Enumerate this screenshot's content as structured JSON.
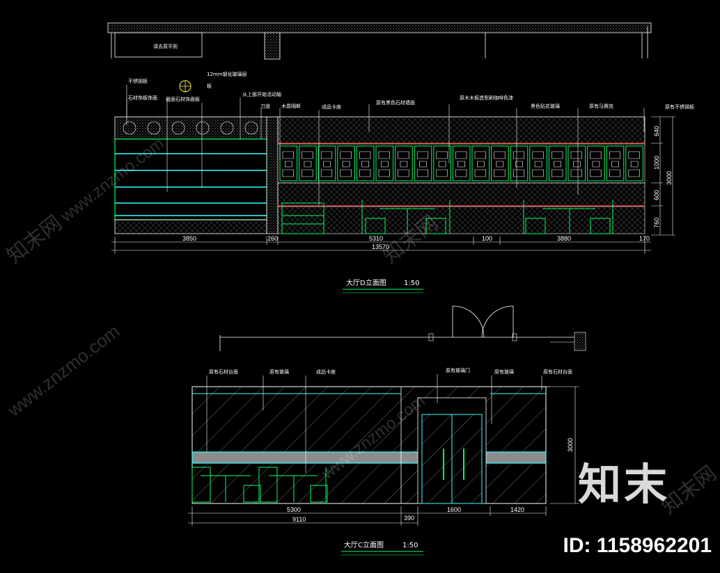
{
  "drawing_d": {
    "title": "大厅D立面图",
    "scale": "1:50",
    "top_note": "请去原平则",
    "labels": [
      "不锈钢板",
      "石材饰板饰面",
      "12mm钢化玻璃层",
      "板",
      "截面石材饰面板",
      "从上部开始活动轴",
      "刀道",
      "木质隔断",
      "成品卡座",
      "原有黑色石材墙面",
      "原木木板造型刷咖啡色漆",
      "黑色贴花玻璃",
      "原有马赛克",
      "原有不锈钢板"
    ],
    "dims_bottom": [
      "3850",
      "260",
      "5310",
      "100",
      "3880",
      "170"
    ],
    "dim_total": "13570",
    "dims_right": [
      "640",
      "1000",
      "600",
      "760"
    ],
    "dim_height": "3000"
  },
  "drawing_c": {
    "title": "大厅C立面图",
    "scale": "1:50",
    "labels": [
      "原有石材台面",
      "原有玻璃",
      "成品卡座",
      "原有玻璃门",
      "原有玻璃",
      "原有石材台面"
    ],
    "dims_bottom": [
      "5300",
      "1600",
      "1420"
    ],
    "dims_lower": [
      "9110",
      "390"
    ],
    "dim_height": "3000"
  },
  "watermark": {
    "site": "www.znzmo.com",
    "brand_cn": "知末网",
    "brand": "知末",
    "id_text": "ID: 1158962201"
  },
  "colors": {
    "background": "#000000",
    "line_white": "#ffffff",
    "line_green": "#00ff66",
    "line_cyan": "#33ffff",
    "line_red": "#ff3333",
    "hatch_grey": "#9a9a9a"
  }
}
